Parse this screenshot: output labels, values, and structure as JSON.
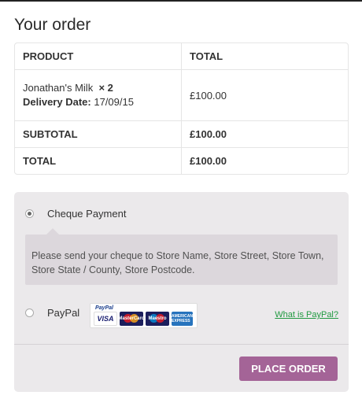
{
  "page": {
    "title": "Your order"
  },
  "order_table": {
    "headers": {
      "product": "PRODUCT",
      "total": "TOTAL"
    },
    "item": {
      "name": "Jonathan's Milk",
      "quantity": "× 2",
      "delivery_label": "Delivery Date:",
      "delivery_value": "17/09/15",
      "total": "£100.00"
    },
    "subtotal": {
      "label": "SUBTOTAL",
      "value": "£100.00"
    },
    "total": {
      "label": "TOTAL",
      "value": "£100.00"
    }
  },
  "payment": {
    "cheque": {
      "label": "Cheque Payment",
      "selected": true,
      "description": "Please send your cheque to Store Name, Store Street, Store Town, Store State / County, Store Postcode."
    },
    "paypal": {
      "label": "PayPal",
      "selected": false,
      "mark_brand": "PayPal",
      "cards": [
        "VISA",
        "MasterCard",
        "Maestro",
        "AMERICAN EXPRESS"
      ],
      "link": "What is PayPal?"
    },
    "place_order": "PLACE ORDER"
  },
  "colors": {
    "payment_bg": "#ebe9eb",
    "notice_bg": "#dcd7dc",
    "button": "#a46497",
    "link": "#229a42"
  }
}
